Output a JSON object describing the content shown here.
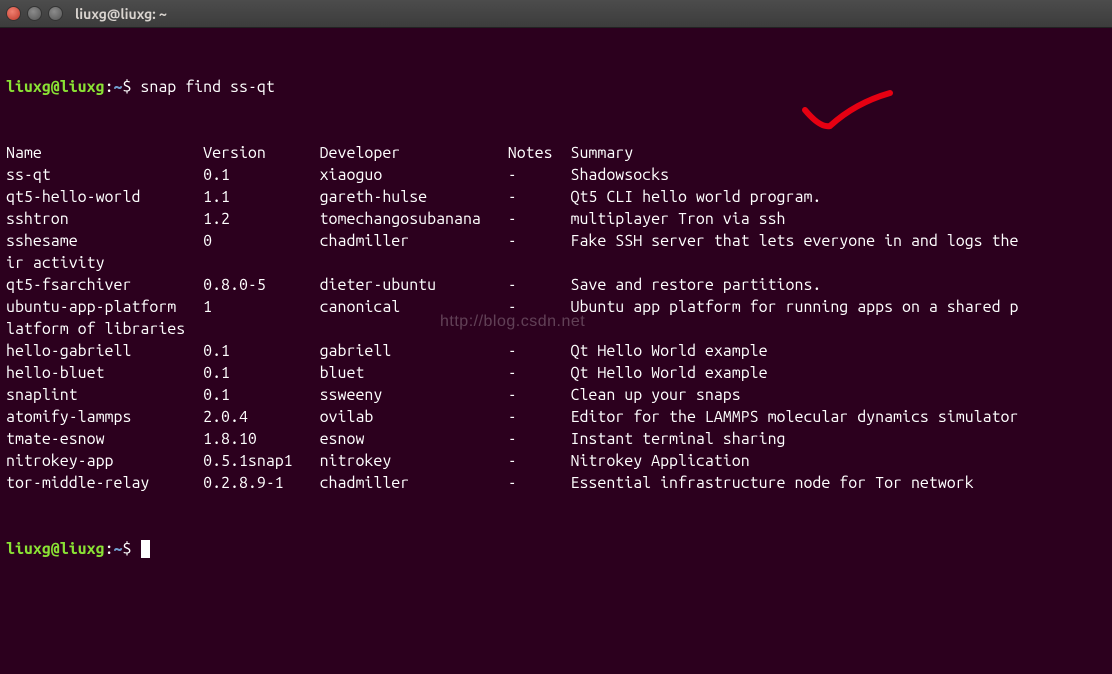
{
  "window": {
    "title": "liuxg@liuxg: ~"
  },
  "prompt": {
    "user_host": "liuxg@liuxg",
    "path": "~",
    "command": "snap find ss-qt"
  },
  "columns": {
    "name": "Name",
    "version": "Version",
    "developer": "Developer",
    "notes": "Notes",
    "summary": "Summary"
  },
  "rows": [
    {
      "name": "ss-qt",
      "version": "0.1",
      "developer": "xiaoguo",
      "notes": "-",
      "summary": "Shadowsocks"
    },
    {
      "name": "qt5-hello-world",
      "version": "1.1",
      "developer": "gareth-hulse",
      "notes": "-",
      "summary": "Qt5 CLI hello world program."
    },
    {
      "name": "sshtron",
      "version": "1.2",
      "developer": "tomechangosubanana",
      "notes": "-",
      "summary": "multiplayer Tron via ssh"
    },
    {
      "name": "sshesame",
      "version": "0",
      "developer": "chadmiller",
      "notes": "-",
      "summary": "Fake SSH server that lets everyone in and logs their activity"
    },
    {
      "name": "qt5-fsarchiver",
      "version": "0.8.0-5",
      "developer": "dieter-ubuntu",
      "notes": "-",
      "summary": "Save and restore partitions."
    },
    {
      "name": "ubuntu-app-platform",
      "version": "1",
      "developer": "canonical",
      "notes": "-",
      "summary": "Ubuntu app platform for running apps on a shared platform of libraries"
    },
    {
      "name": "hello-gabriell",
      "version": "0.1",
      "developer": "gabriell",
      "notes": "-",
      "summary": "Qt Hello World example"
    },
    {
      "name": "hello-bluet",
      "version": "0.1",
      "developer": "bluet",
      "notes": "-",
      "summary": "Qt Hello World example"
    },
    {
      "name": "snaplint",
      "version": "0.1",
      "developer": "ssweeny",
      "notes": "-",
      "summary": "Clean up your snaps"
    },
    {
      "name": "atomify-lammps",
      "version": "2.0.4",
      "developer": "ovilab",
      "notes": "-",
      "summary": "Editor for the LAMMPS molecular dynamics simulator"
    },
    {
      "name": "tmate-esnow",
      "version": "1.8.10",
      "developer": "esnow",
      "notes": "-",
      "summary": "Instant terminal sharing"
    },
    {
      "name": "nitrokey-app",
      "version": "0.5.1snap1",
      "developer": "nitrokey",
      "notes": "-",
      "summary": "Nitrokey Application"
    },
    {
      "name": "tor-middle-relay",
      "version": "0.2.8.9-1",
      "developer": "chadmiller",
      "notes": "-",
      "summary": "Essential infrastructure node for Tor network"
    }
  ],
  "layout": {
    "col_name": 22,
    "col_version": 13,
    "col_developer": 21,
    "col_notes": 7,
    "wrap_width": 113
  },
  "watermark": "http://blog.csdn.net",
  "annotation": {
    "icon": "red-checkmark",
    "target_row": 0
  }
}
